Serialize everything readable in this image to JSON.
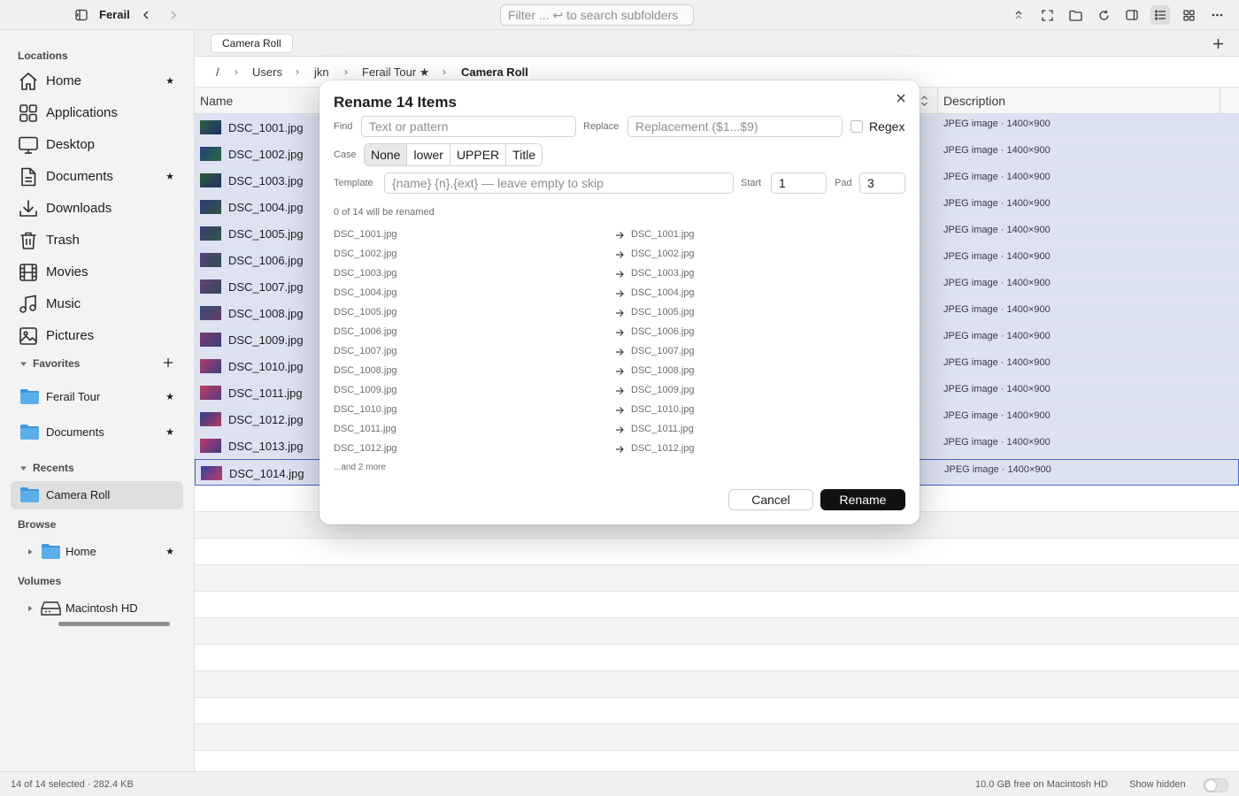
{
  "app": {
    "title": "Ferail"
  },
  "toolbar": {
    "filter_placeholder": "Filter ... ↩ to search subfolders"
  },
  "tabs": [
    {
      "label": "Camera Roll"
    }
  ],
  "breadcrumb": [
    "/",
    "Users",
    "jkn",
    "Ferail Tour ★",
    "Camera Roll"
  ],
  "sidebar": {
    "locations_header": "Locations",
    "locations": [
      {
        "label": "Home",
        "icon": "home-icon",
        "starred": "★"
      },
      {
        "label": "Applications",
        "icon": "applications-icon"
      },
      {
        "label": "Desktop",
        "icon": "desktop-icon"
      },
      {
        "label": "Documents",
        "icon": "document-icon",
        "starred": "★"
      },
      {
        "label": "Downloads",
        "icon": "download-icon"
      },
      {
        "label": "Trash",
        "icon": "trash-icon"
      },
      {
        "label": "Movies",
        "icon": "film-icon"
      },
      {
        "label": "Music",
        "icon": "music-note-icon"
      },
      {
        "label": "Pictures",
        "icon": "photo-icon"
      }
    ],
    "favorites_header": "Favorites",
    "favorites": [
      {
        "label": "Ferail Tour",
        "starred": "★"
      },
      {
        "label": "Documents",
        "starred": "★"
      }
    ],
    "recents_header": "Recents",
    "recents": [
      {
        "label": "Camera Roll"
      }
    ],
    "browse_header": "Browse",
    "browse": [
      {
        "label": "Home",
        "starred": "★"
      }
    ],
    "volumes_header": "Volumes",
    "volumes": [
      {
        "label": "Macintosh HD"
      }
    ]
  },
  "columns": {
    "name": "Name",
    "description": "Description"
  },
  "files": [
    {
      "name": "DSC_1001.jpg",
      "desc": "JPEG image · 1400×900",
      "thumb": [
        "#2f5f3a",
        "#1c2f73"
      ]
    },
    {
      "name": "DSC_1002.jpg",
      "desc": "JPEG image · 1400×900",
      "thumb": [
        "#233f7e",
        "#2a6a40"
      ]
    },
    {
      "name": "DSC_1003.jpg",
      "desc": "JPEG image · 1400×900",
      "thumb": [
        "#2d5a33",
        "#24306f"
      ]
    },
    {
      "name": "DSC_1004.jpg",
      "desc": "JPEG image · 1400×900",
      "thumb": [
        "#2b3b7a",
        "#31573e"
      ]
    },
    {
      "name": "DSC_1005.jpg",
      "desc": "JPEG image · 1400×900",
      "thumb": [
        "#3d3b73",
        "#2c5a45"
      ]
    },
    {
      "name": "DSC_1006.jpg",
      "desc": "JPEG image · 1400×900",
      "thumb": [
        "#57407a",
        "#2e4f52"
      ]
    },
    {
      "name": "DSC_1007.jpg",
      "desc": "JPEG image · 1400×900",
      "thumb": [
        "#6a3f72",
        "#2f4a5e"
      ]
    },
    {
      "name": "DSC_1008.jpg",
      "desc": "JPEG image · 1400×900",
      "thumb": [
        "#2f4f74",
        "#6a3c6a"
      ]
    },
    {
      "name": "DSC_1009.jpg",
      "desc": "JPEG image · 1400×900",
      "thumb": [
        "#7a3a6a",
        "#3a3f80"
      ]
    },
    {
      "name": "DSC_1010.jpg",
      "desc": "JPEG image · 1400×900",
      "thumb": [
        "#b23c6a",
        "#3c3f82"
      ]
    },
    {
      "name": "DSC_1011.jpg",
      "desc": "JPEG image · 1400×900",
      "thumb": [
        "#c03c66",
        "#5a3a7a"
      ]
    },
    {
      "name": "DSC_1012.jpg",
      "desc": "JPEG image · 1400×900",
      "thumb": [
        "#2c3f8a",
        "#b03a5e"
      ]
    },
    {
      "name": "DSC_1013.jpg",
      "desc": "JPEG image · 1400×900",
      "thumb": [
        "#c2386a",
        "#3a3c86"
      ]
    },
    {
      "name": "DSC_1014.jpg",
      "desc": "JPEG image · 1400×900",
      "thumb": [
        "#3040a0",
        "#c23e68"
      ]
    }
  ],
  "dialog": {
    "title": "Rename 14 Items",
    "find_label": "Find",
    "find_placeholder": "Text or pattern",
    "replace_label": "Replace",
    "replace_placeholder": "Replacement ($1...$9)",
    "regex_label": "Regex",
    "case_label": "Case",
    "case_options": [
      "None",
      "lower",
      "UPPER",
      "Title"
    ],
    "case_selected": "None",
    "template_label": "Template",
    "template_placeholder": "{name} {n}.{ext} — leave empty to skip",
    "start_label": "Start",
    "start_value": "1",
    "pad_label": "Pad",
    "pad_value": "3",
    "count_text": "0 of 14 will be renamed",
    "preview": [
      {
        "from": "DSC_1001.jpg",
        "to": "DSC_1001.jpg"
      },
      {
        "from": "DSC_1002.jpg",
        "to": "DSC_1002.jpg"
      },
      {
        "from": "DSC_1003.jpg",
        "to": "DSC_1003.jpg"
      },
      {
        "from": "DSC_1004.jpg",
        "to": "DSC_1004.jpg"
      },
      {
        "from": "DSC_1005.jpg",
        "to": "DSC_1005.jpg"
      },
      {
        "from": "DSC_1006.jpg",
        "to": "DSC_1006.jpg"
      },
      {
        "from": "DSC_1007.jpg",
        "to": "DSC_1007.jpg"
      },
      {
        "from": "DSC_1008.jpg",
        "to": "DSC_1008.jpg"
      },
      {
        "from": "DSC_1009.jpg",
        "to": "DSC_1009.jpg"
      },
      {
        "from": "DSC_1010.jpg",
        "to": "DSC_1010.jpg"
      },
      {
        "from": "DSC_1011.jpg",
        "to": "DSC_1011.jpg"
      },
      {
        "from": "DSC_1012.jpg",
        "to": "DSC_1012.jpg"
      }
    ],
    "more_text": "...and 2 more",
    "cancel_label": "Cancel",
    "rename_label": "Rename"
  },
  "status": {
    "selection": "14 of 14 selected · 282.4 KB",
    "free_space": "10.0 GB free on Macintosh HD",
    "show_hidden_label": "Show hidden"
  },
  "colors": {
    "selection_row": "#dde2f2",
    "focus_border": "#4a63c6",
    "folder_blue": "#5aaeea",
    "primary_button": "#111111"
  }
}
